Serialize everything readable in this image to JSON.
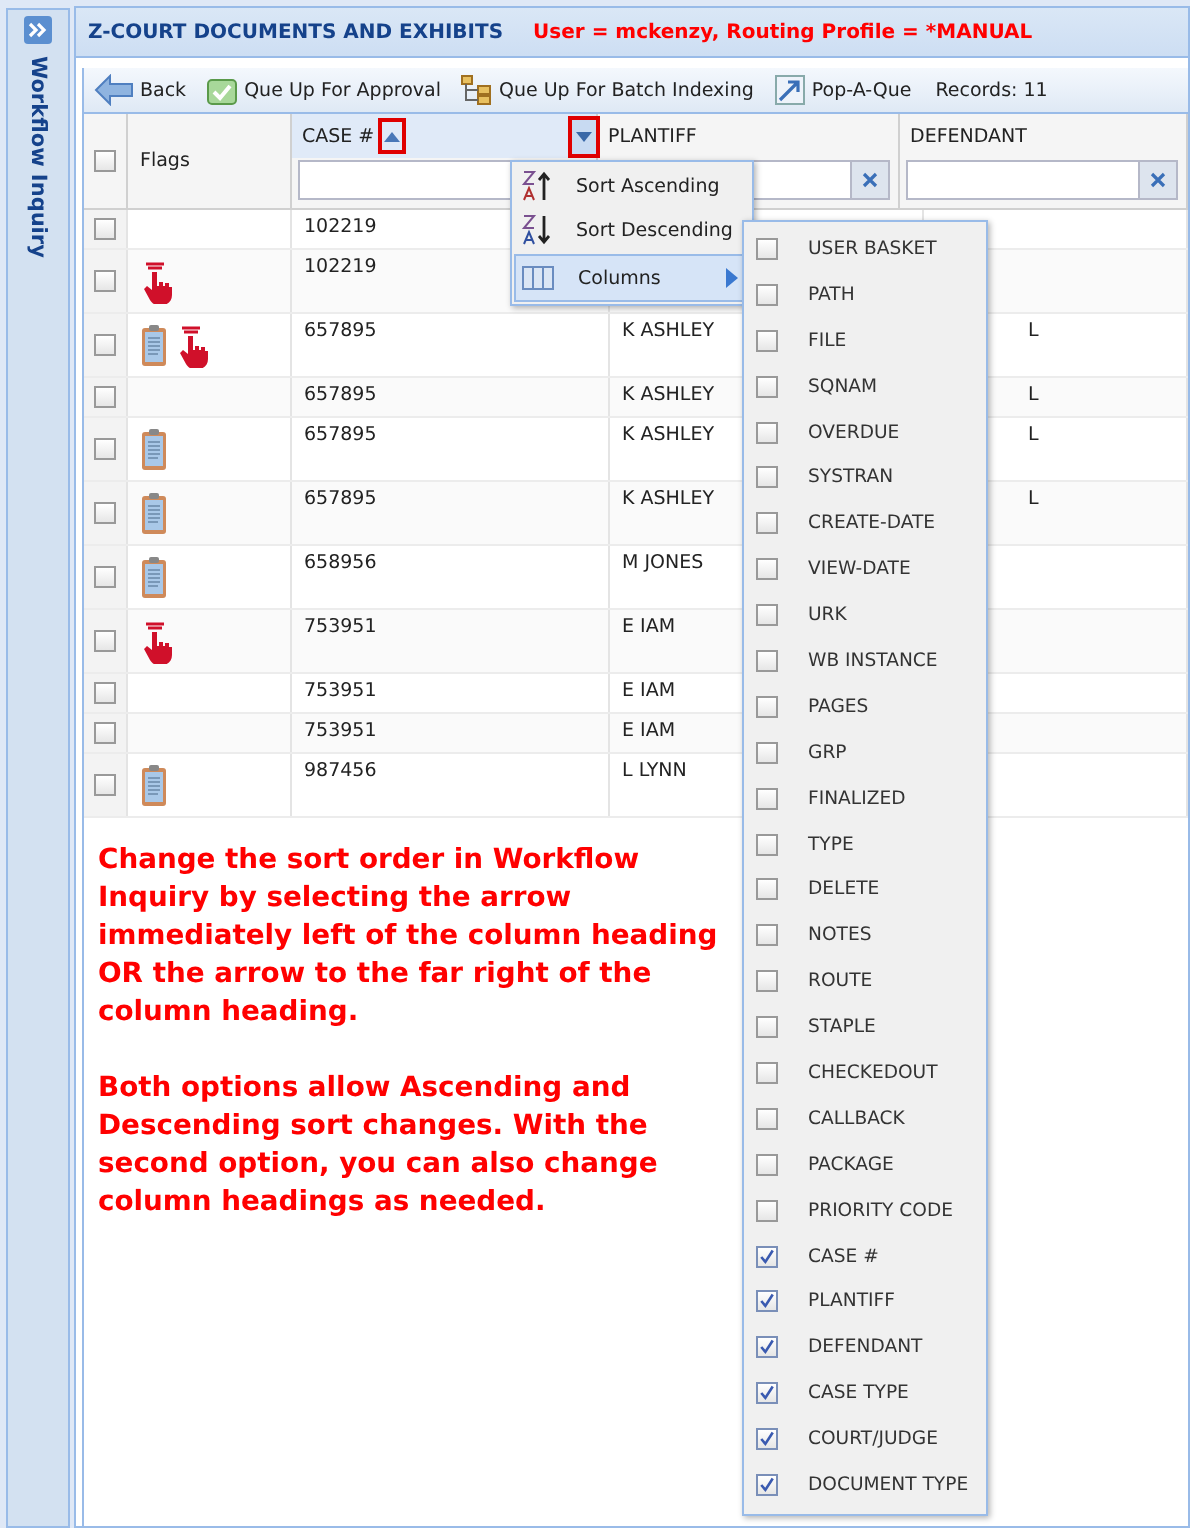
{
  "sidebar": {
    "title": "Workflow Inquiry"
  },
  "panel": {
    "title": "Z-COURT DOCUMENTS AND EXHIBITS",
    "user_info": "User = mckenzy, Routing Profile = *MANUAL"
  },
  "toolbar": {
    "buttons": [
      {
        "label": "Back",
        "kind": "back"
      },
      {
        "label": "Que Up For Approval",
        "kind": "approval"
      },
      {
        "label": "Que Up For Batch Indexing",
        "kind": "batch"
      },
      {
        "label": "Pop-A-Que",
        "kind": "pop"
      }
    ],
    "records": "Records: 11"
  },
  "table": {
    "select_all": {
      "checked": false
    },
    "columns": [
      {
        "label": "Flags",
        "kind": "flags"
      },
      {
        "label": "CASE #",
        "kind": "case",
        "sort_ascending": true,
        "callout": true,
        "menu_callout": true
      },
      {
        "label": "PLANTIFF",
        "kind": "plaintiff"
      },
      {
        "label": "DEFENDANT",
        "kind": "defendant"
      }
    ],
    "rows": [
      {
        "checked": false,
        "flags": [],
        "case": "102219",
        "plaintiff": "",
        "defendant": ""
      },
      {
        "checked": false,
        "flags": [
          {
            "kind": "hand"
          }
        ],
        "case": "102219",
        "plaintiff": "",
        "defendant": ""
      },
      {
        "checked": false,
        "flags": [
          {
            "kind": "clipboard"
          },
          {
            "kind": "hand"
          }
        ],
        "case": "657895",
        "plaintiff": "K ASHLEY",
        "defendant": "L"
      },
      {
        "checked": false,
        "flags": [],
        "case": "657895",
        "plaintiff": "K ASHLEY",
        "defendant": "L"
      },
      {
        "checked": false,
        "flags": [
          {
            "kind": "clipboard"
          }
        ],
        "case": "657895",
        "plaintiff": "K ASHLEY",
        "defendant": "L"
      },
      {
        "checked": false,
        "flags": [
          {
            "kind": "clipboard"
          }
        ],
        "case": "657895",
        "plaintiff": "K ASHLEY",
        "defendant": "L"
      },
      {
        "checked": false,
        "flags": [
          {
            "kind": "clipboard"
          }
        ],
        "case": "658956",
        "plaintiff": "M JONES",
        "defendant": ""
      },
      {
        "checked": false,
        "flags": [
          {
            "kind": "hand"
          }
        ],
        "case": "753951",
        "plaintiff": "E IAM",
        "defendant": ""
      },
      {
        "checked": false,
        "flags": [],
        "case": "753951",
        "plaintiff": "E IAM",
        "defendant": ""
      },
      {
        "checked": false,
        "flags": [],
        "case": "753951",
        "plaintiff": "E IAM",
        "defendant": ""
      },
      {
        "checked": false,
        "flags": [
          {
            "kind": "clipboard"
          }
        ],
        "case": "987456",
        "plaintiff": "L LYNN",
        "defendant": ""
      }
    ]
  },
  "sort_menu": {
    "items": [
      {
        "label": "Sort Ascending",
        "kind": "asc"
      },
      {
        "label": "Sort Descending",
        "kind": "desc"
      },
      {
        "label": "Columns",
        "kind": "columns",
        "expanded": true
      }
    ]
  },
  "columns_menu": {
    "items": [
      {
        "label": "USER BASKET",
        "checked": false
      },
      {
        "label": "PATH",
        "checked": false
      },
      {
        "label": "FILE",
        "checked": false
      },
      {
        "label": "SQNAM",
        "checked": false
      },
      {
        "label": "OVERDUE",
        "checked": false
      },
      {
        "label": "SYSTRAN",
        "checked": false
      },
      {
        "label": "CREATE-DATE",
        "checked": false
      },
      {
        "label": "VIEW-DATE",
        "checked": false
      },
      {
        "label": "URK",
        "checked": false
      },
      {
        "label": "WB INSTANCE",
        "checked": false
      },
      {
        "label": "PAGES",
        "checked": false
      },
      {
        "label": "GRP",
        "checked": false
      },
      {
        "label": "FINALIZED",
        "checked": false
      },
      {
        "label": "TYPE",
        "checked": false
      },
      {
        "label": "DELETE",
        "checked": false
      },
      {
        "label": "NOTES",
        "checked": false
      },
      {
        "label": "ROUTE",
        "checked": false
      },
      {
        "label": "STAPLE",
        "checked": false
      },
      {
        "label": "CHECKEDOUT",
        "checked": false
      },
      {
        "label": "CALLBACK",
        "checked": false
      },
      {
        "label": "PACKAGE",
        "checked": false
      },
      {
        "label": "PRIORITY CODE",
        "checked": false
      },
      {
        "label": "CASE #",
        "checked": true
      },
      {
        "label": "PLANTIFF",
        "checked": true
      },
      {
        "label": "DEFENDANT",
        "checked": true
      },
      {
        "label": "CASE TYPE",
        "checked": true
      },
      {
        "label": "COURT/JUDGE",
        "checked": true
      },
      {
        "label": "DOCUMENT TYPE",
        "checked": true
      }
    ]
  },
  "note": {
    "paragraphs": [
      "Change the sort order in Workflow Inquiry by selecting the arrow immediately left of the column heading OR the arrow to the far right of the column heading.",
      "Both options allow Ascending and Descending sort changes. With the second option, you can also change column headings as needed."
    ]
  }
}
